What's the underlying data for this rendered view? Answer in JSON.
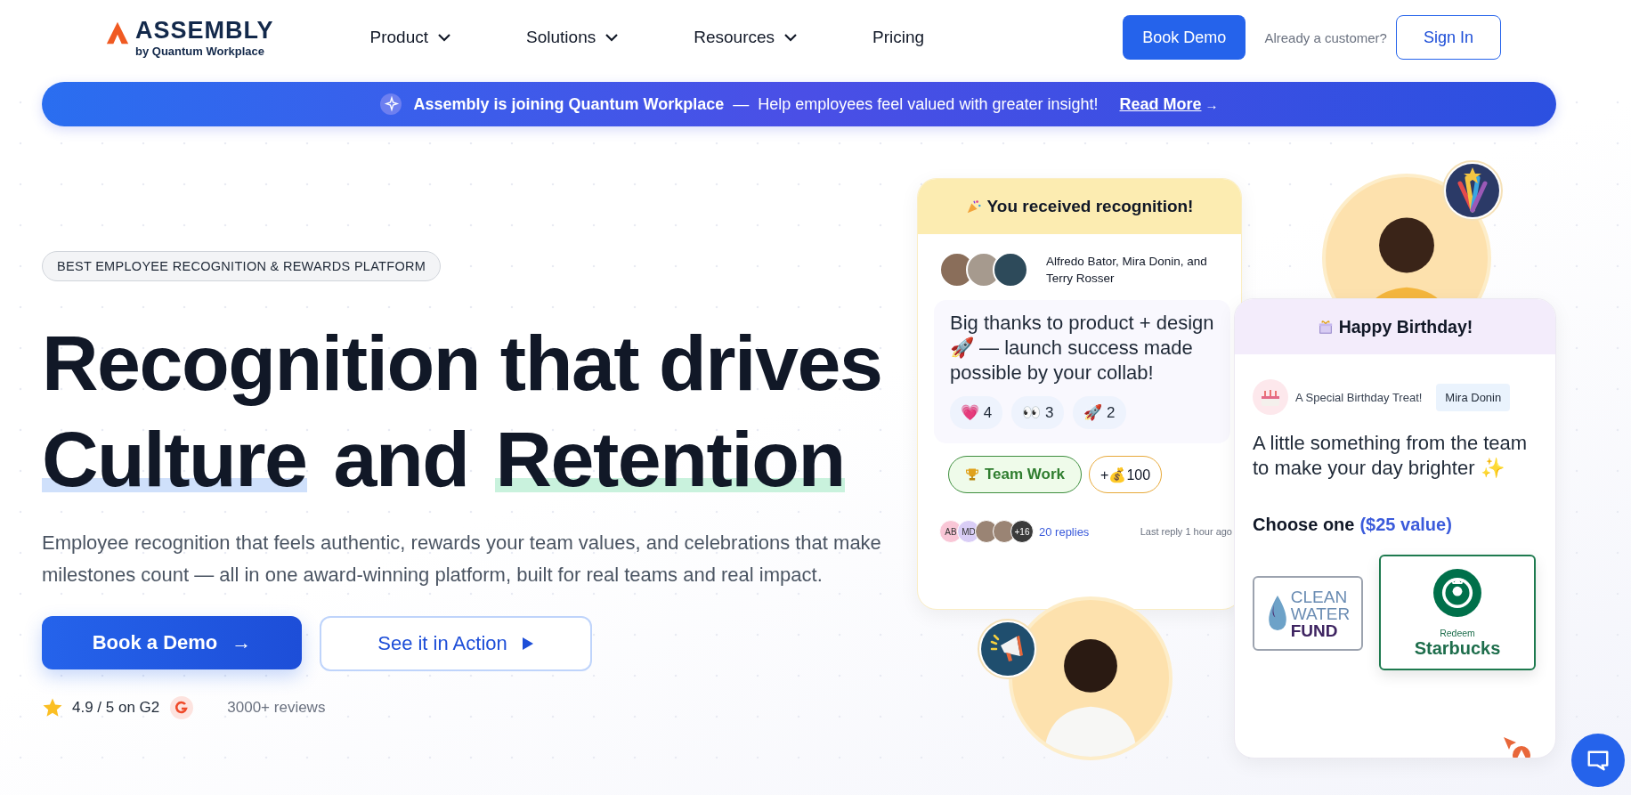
{
  "logo": {
    "wordmark": "ASSEMBLY",
    "byline": "by Quantum Workplace"
  },
  "nav": [
    {
      "label": "Product",
      "has_menu": true
    },
    {
      "label": "Solutions",
      "has_menu": true
    },
    {
      "label": "Resources",
      "has_menu": true
    },
    {
      "label": "Pricing",
      "has_menu": false
    }
  ],
  "header_actions": {
    "demo_button": "Book Demo",
    "customer_prompt": "Already a customer?",
    "sign_in": "Sign In"
  },
  "banner": {
    "headline": "Assembly is joining Quantum Workplace",
    "separator": "—",
    "message": "Help employees feel valued with greater insight!",
    "link": "Read More",
    "link_arrow": "→"
  },
  "hero": {
    "tag": "BEST EMPLOYEE RECOGNITION & REWARDS PLATFORM",
    "title_line": "Recognition that drives",
    "highlight_words": [
      {
        "text": "Culture",
        "color": "#cfe0fb"
      },
      {
        "text": "Retention",
        "color": "#c9f2dd"
      }
    ],
    "connector": "and",
    "subtitle": "Employee recognition that feels authentic, rewards your team values, and celebrations that make milestones count — all in one award-winning platform, built for real teams and real impact.",
    "primary_button": "Book a Demo",
    "primary_arrow": "→",
    "secondary_button": "See it in Action",
    "rating": "4.9 / 5 on G2",
    "reviews": "3000+ reviews"
  },
  "recognition_card": {
    "title": "You received recognition!",
    "authors": "Alfredo Bator, Mira Donin, and Terry Rosser",
    "message": "Big thanks to product + design 🚀 — launch success made possible by your collab!",
    "reactions": [
      {
        "emoji": "💗",
        "count": "4"
      },
      {
        "emoji": "👀",
        "count": "3"
      },
      {
        "emoji": "🚀",
        "count": "2"
      }
    ],
    "value_tag": "Team Work",
    "points": "+💰100",
    "repliers": [
      {
        "kind": "initials",
        "text": "AB",
        "color": "#f9c6d6"
      },
      {
        "kind": "initials",
        "text": "MD",
        "color": "#d9cdf6"
      },
      {
        "kind": "photo"
      },
      {
        "kind": "photo"
      },
      {
        "kind": "count",
        "text": "+16",
        "color": "#3b3b3b"
      }
    ],
    "replies": "20 replies",
    "last_reply": "Last reply 1 hour ago"
  },
  "birthday_card": {
    "title": "Happy Birthday!",
    "treat": "A Special Birthday Treat!",
    "recipient": "Mira Donin",
    "message": "A little something from the team to make your day brighter ✨",
    "choose_label": "Choose one",
    "value_note": "($25 value)",
    "rewards": [
      {
        "kind": "logo",
        "lines": [
          "CLEAN",
          "WATER",
          "FUND"
        ],
        "selected": false
      },
      {
        "kind": "redeem",
        "caption": "Redeem",
        "name": "Starbucks",
        "selected": true
      }
    ]
  }
}
